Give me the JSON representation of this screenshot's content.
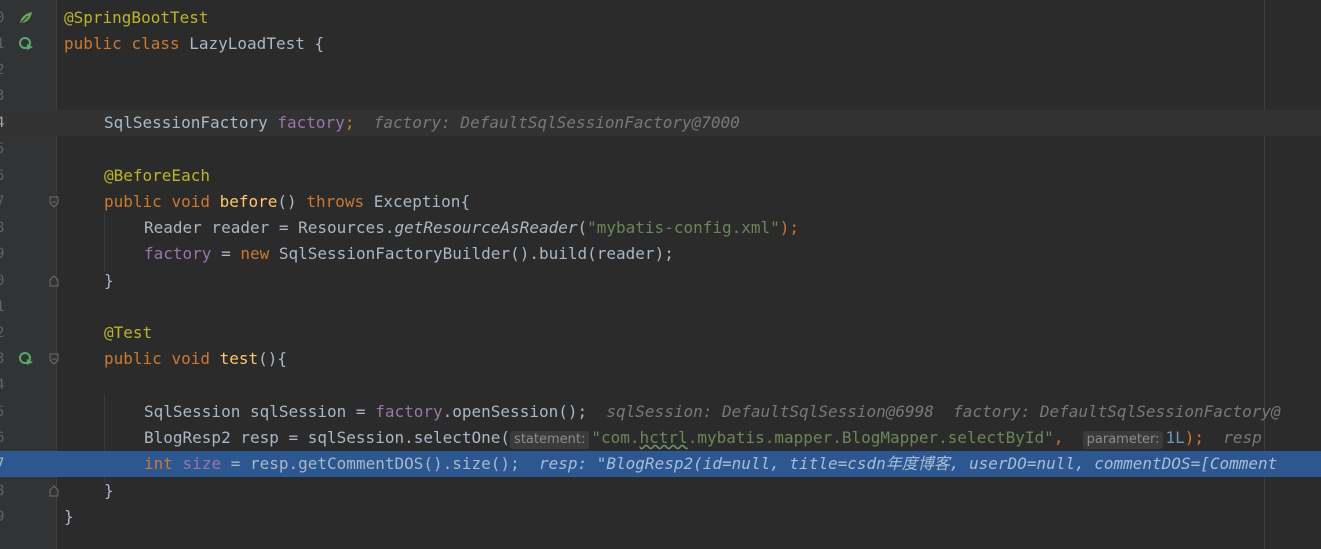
{
  "lines": [
    {
      "num": "0",
      "tokens": [
        "@SpringBootTest"
      ]
    },
    {
      "num": "1",
      "tokens": [
        "public",
        "class",
        "LazyLoadTest {"
      ]
    },
    {
      "num": "2"
    },
    {
      "num": "3"
    },
    {
      "num": "4",
      "tokens": [
        "SqlSessionFactory ",
        "factory",
        ";"
      ],
      "hint": "factory: DefaultSqlSessionFactory@7000"
    },
    {
      "num": "5"
    },
    {
      "num": "6",
      "tokens": [
        "@BeforeEach"
      ]
    },
    {
      "num": "7",
      "tokens": [
        "public",
        "void",
        "before",
        "() ",
        "throws",
        " Exception{"
      ]
    },
    {
      "num": "8",
      "tokens": [
        "Reader reader = Resources.",
        "getResourceAsReader",
        "(",
        "\"mybatis-config.xml\"",
        ");"
      ]
    },
    {
      "num": "9",
      "tokens": [
        "factory",
        " = ",
        "new",
        " SqlSessionFactoryBuilder().build(reader);"
      ]
    },
    {
      "num": "0",
      "tokens": [
        "}"
      ]
    },
    {
      "num": "1"
    },
    {
      "num": "2",
      "tokens": [
        "@Test"
      ]
    },
    {
      "num": "3",
      "tokens": [
        "public",
        "void",
        "test",
        "(){"
      ]
    },
    {
      "num": "4"
    },
    {
      "num": "5",
      "tokens": [
        "SqlSession sqlSession = ",
        "factory",
        ".openSession();"
      ],
      "hints": [
        "sqlSession: DefaultSqlSession@6998",
        "factory: DefaultSqlSessionFactory@"
      ]
    },
    {
      "num": "6",
      "tokens": [
        "BlogResp2 resp = sqlSession.selectOne(",
        "statement:",
        "\"com.",
        "hctrl",
        ".mybatis.mapper.BlogMapper.selectById\"",
        ", ",
        "parameter:",
        "1L",
        ");"
      ],
      "hint": "resp"
    },
    {
      "num": "7",
      "tokens": [
        "int",
        "size",
        " = resp.getCommentDOS().size();"
      ],
      "hint": "resp: \"BlogResp2(id=null, title=csdn年度博客, userDO=null, commentDOS=[Comment"
    },
    {
      "num": "8",
      "tokens": [
        "}"
      ]
    },
    {
      "num": "9",
      "tokens": [
        "}"
      ]
    }
  ],
  "gutter_icons": {
    "spring_bean": "spring-leaf-icon",
    "run_test": "run-test-icon",
    "fold": "fold-marker-icon"
  },
  "colors": {
    "background": "#2b2b2b",
    "gutter": "#313335",
    "keyword": "#cc7832",
    "annotation": "#bbb529",
    "field": "#9876aa",
    "method": "#ffc66d",
    "string": "#6a8759",
    "number": "#6897bb",
    "selection": "#2d5790"
  }
}
